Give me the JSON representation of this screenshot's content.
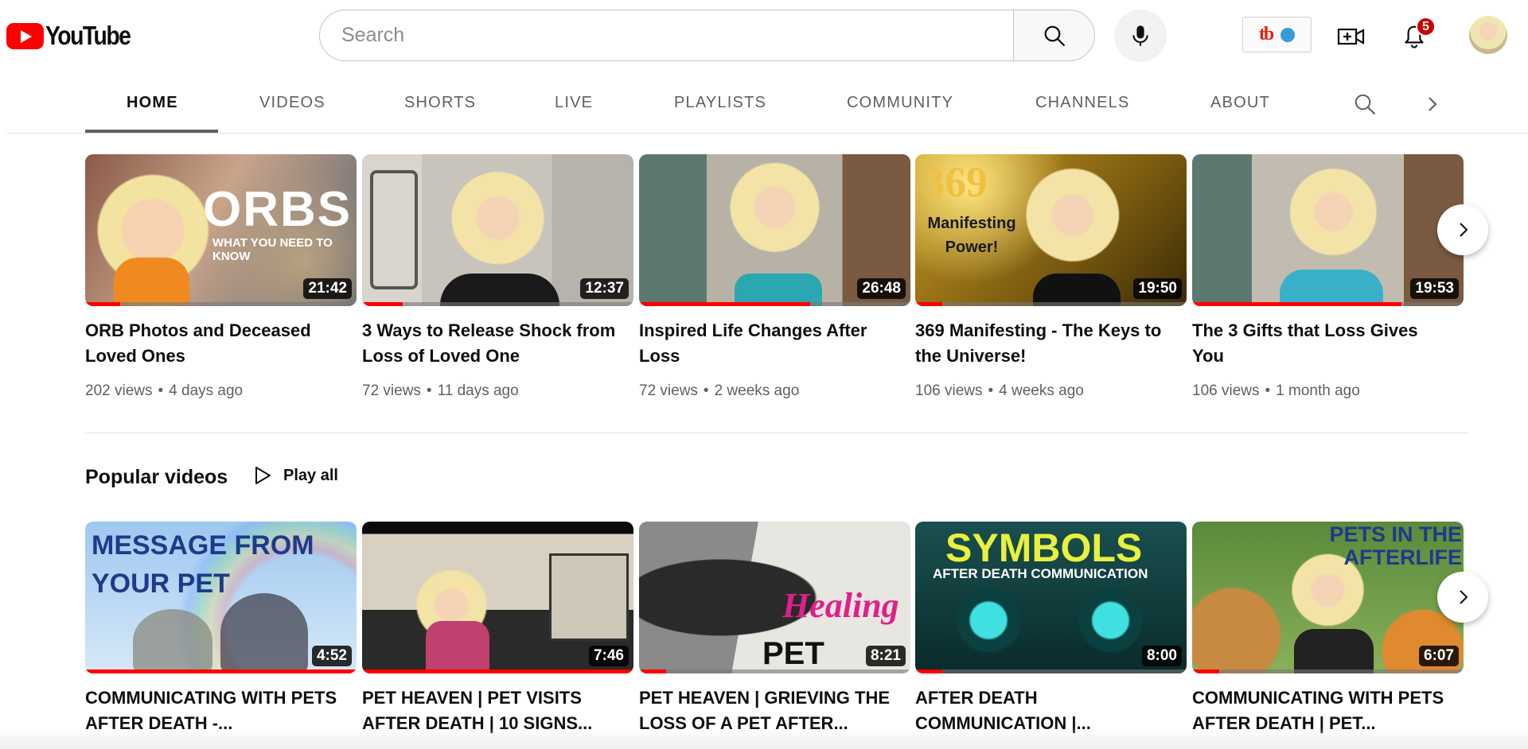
{
  "header": {
    "logo_text": "YouTube",
    "search_placeholder": "Search",
    "notification_count": "5",
    "extension_name": "tubebuddy",
    "colors": {
      "brand_red": "#ff0000",
      "badge_red": "#cc0000",
      "extension_dot": "#3a9ad9"
    }
  },
  "tabs": [
    {
      "label": "HOME",
      "active": true
    },
    {
      "label": "VIDEOS",
      "active": false
    },
    {
      "label": "SHORTS",
      "active": false
    },
    {
      "label": "LIVE",
      "active": false
    },
    {
      "label": "PLAYLISTS",
      "active": false
    },
    {
      "label": "COMMUNITY",
      "active": false
    },
    {
      "label": "CHANNELS",
      "active": false
    },
    {
      "label": "ABOUT",
      "active": false
    }
  ],
  "shelf1": {
    "videos": [
      {
        "title": "ORB Photos and Deceased Loved Ones",
        "views": "202 views",
        "age": "4 days ago",
        "duration": "21:42",
        "thumb_text": "ORBS",
        "thumb_subtext": "WHAT YOU NEED TO KNOW",
        "watched": 0.13
      },
      {
        "title": "3 Ways to Release Shock from Loss of Loved One",
        "views": "72 views",
        "age": "11 days ago",
        "duration": "12:37",
        "watched": 0.15
      },
      {
        "title": "Inspired Life Changes After Loss",
        "views": "72 views",
        "age": "2 weeks ago",
        "duration": "26:48",
        "watched": 0.63
      },
      {
        "title": "369 Manifesting - The Keys to the Universe!",
        "views": "106 views",
        "age": "4 weeks ago",
        "duration": "19:50",
        "thumb_text": "369",
        "thumb_subtext": "Manifesting Power!",
        "watched": 0.1
      },
      {
        "title": "The 3 Gifts that Loss Gives You",
        "views": "106 views",
        "age": "1 month ago",
        "duration": "19:53",
        "watched": 0.77
      }
    ]
  },
  "shelf2": {
    "title": "Popular videos",
    "play_all_label": "Play all",
    "videos": [
      {
        "title": "COMMUNICATING WITH PETS AFTER DEATH -...",
        "duration": "4:52",
        "thumb_text": "MESSAGE FROM YOUR PET",
        "watched": 1.0
      },
      {
        "title": "PET HEAVEN | PET VISITS AFTER DEATH | 10 SIGNS...",
        "duration": "7:46",
        "watched": 1.0
      },
      {
        "title": "PET HEAVEN | GRIEVING THE LOSS OF A PET AFTER...",
        "duration": "8:21",
        "thumb_text": "Healing",
        "thumb_subtext": "PET LOSS",
        "watched": 0.1
      },
      {
        "title": "AFTER DEATH COMMUNICATION |...",
        "duration": "8:00",
        "thumb_text": "SYMBOLS",
        "thumb_subtext": "AFTER DEATH COMMUNICATION",
        "watched": 0.1
      },
      {
        "title": "COMMUNICATING WITH PETS AFTER DEATH | PET...",
        "duration": "6:07",
        "thumb_text": "PETS IN THE AFTERLIFE",
        "watched": 0.1
      }
    ]
  }
}
